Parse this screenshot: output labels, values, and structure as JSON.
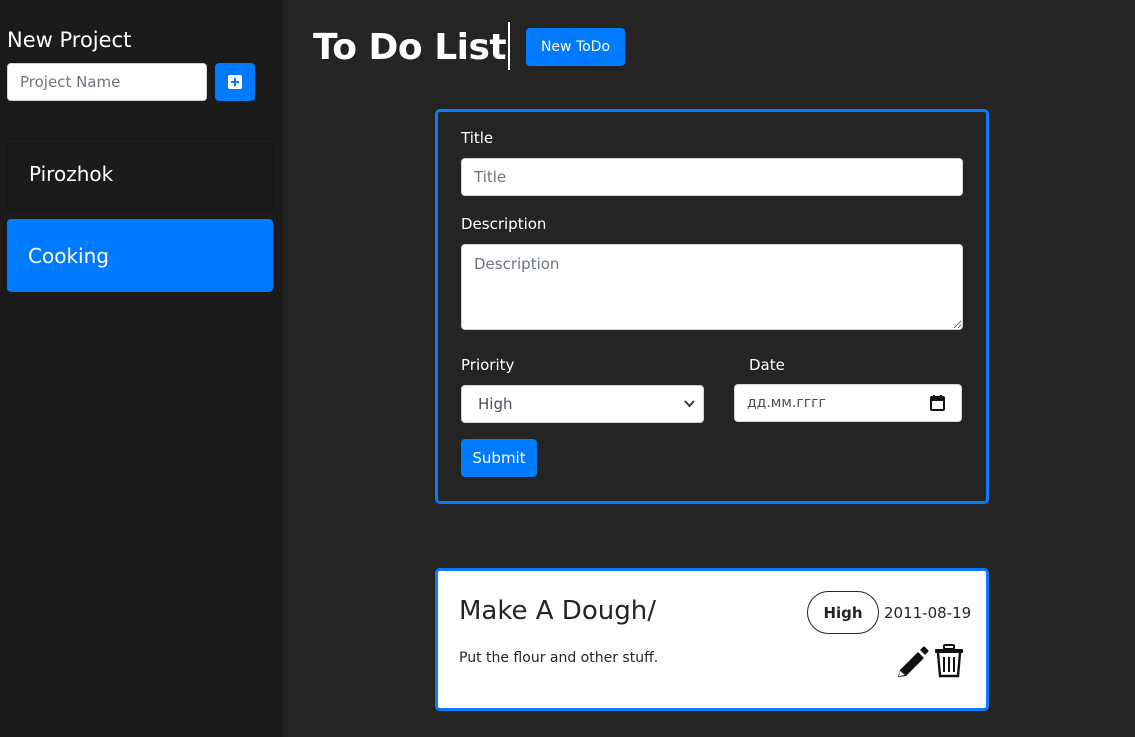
{
  "sidebar": {
    "title": "New Project",
    "project_name_placeholder": "Project Name",
    "add_icon": "plus-square-icon",
    "projects": [
      {
        "label": "Pirozhok",
        "active": false
      },
      {
        "label": "Cooking",
        "active": true
      }
    ]
  },
  "header": {
    "title": "To Do List",
    "new_todo_label": "New ToDo"
  },
  "form": {
    "title_label": "Title",
    "title_placeholder": "Title",
    "description_label": "Description",
    "description_placeholder": "Description",
    "priority_label": "Priority",
    "priority_value": "High",
    "date_label": "Date",
    "date_placeholder": "дд.мм.гггг",
    "submit_label": "Submit"
  },
  "todos": [
    {
      "title": "Make A Dough/",
      "description": "Put the flour and other stuff.",
      "priority": "High",
      "date": "2011-08-19"
    }
  ],
  "colors": {
    "accent": "#007bff",
    "background": "#242424",
    "sidebar": "#1b1b1b"
  }
}
